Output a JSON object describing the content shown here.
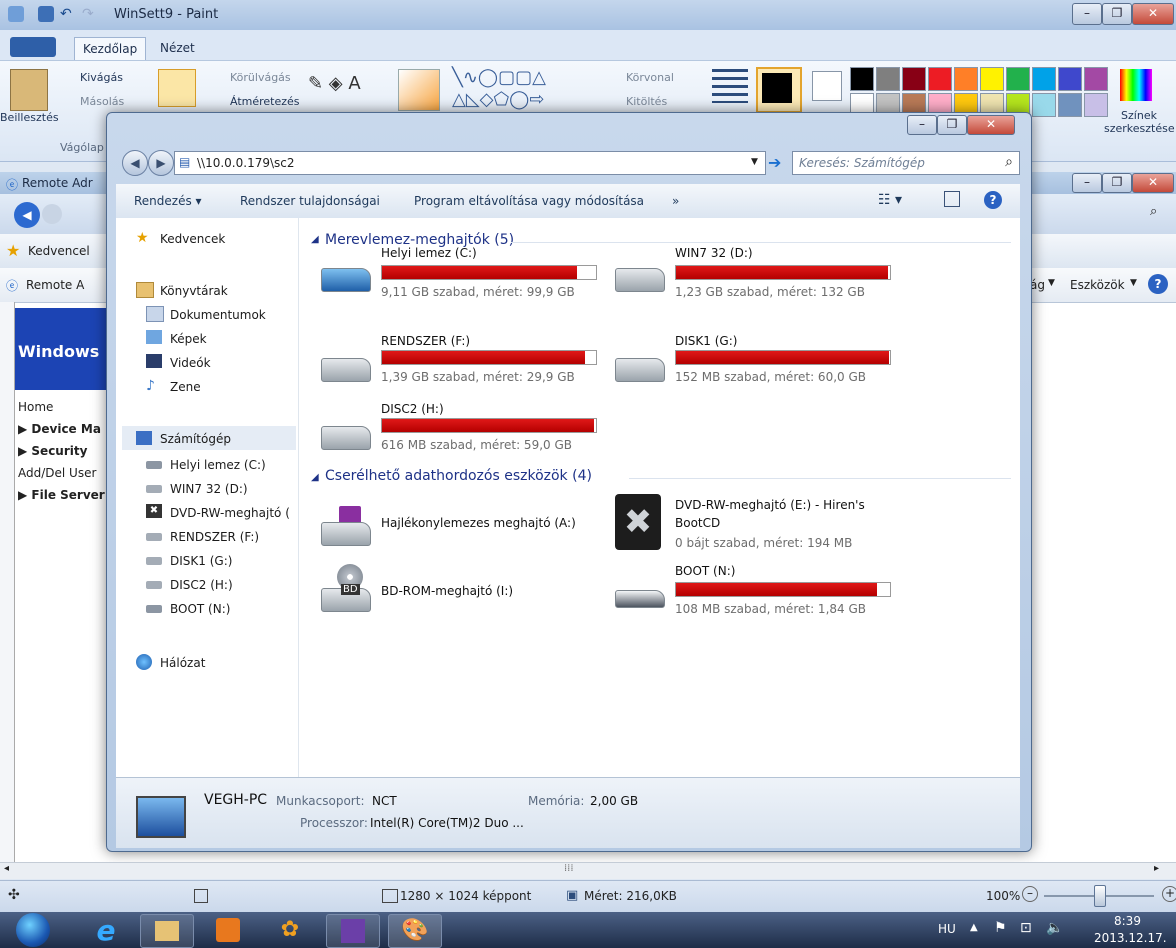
{
  "paint": {
    "title": "WinSett9 - Paint",
    "tabs": [
      "Kezdőlap",
      "Nézet"
    ],
    "clipboard": {
      "paste": "Beillesztés",
      "cut": "Kivágás",
      "copy": "Másolás",
      "group": "Vágólap"
    },
    "image": {
      "crop": "Körülvágás",
      "resize": "Átméretezés"
    },
    "shapes": {
      "outline": "Körvonal",
      "fill": "Kitöltés"
    },
    "colors_edit": "Színek szerkesztése",
    "palette_row1": [
      "#000000",
      "#7f7f7f",
      "#880015",
      "#ed1c24",
      "#ff7f27",
      "#fff200",
      "#22b14c",
      "#00a2e8",
      "#3f48cc",
      "#a349a4"
    ],
    "palette_row2": [
      "#ffffff",
      "#c3c3c3",
      "#b97a57",
      "#ffaec9",
      "#ffc90e",
      "#efe4b0",
      "#b5e61d",
      "#99d9ea",
      "#7092be",
      "#c8bfe7"
    ],
    "status": {
      "dimensions": "1280 × 1024 képpont",
      "size": "Méret: 216,0KB",
      "zoom": "100%"
    }
  },
  "ie": {
    "title": "Remote Adr",
    "favorites": "Kedvencel",
    "tab": "Remote A",
    "tools": "Eszközök",
    "page_menu": "ág",
    "banner": "Windows",
    "nav": [
      "Home",
      "Device Ma",
      "Security",
      "Add/Del User",
      "File Server"
    ]
  },
  "explorer": {
    "address": "\\\\10.0.0.179\\sc2",
    "search_placeholder": "Keresés: Számítógép",
    "commands": [
      "Rendezés",
      "Rendszer tulajdonságai",
      "Program eltávolítása vagy módosítása",
      "»"
    ],
    "nav": {
      "favorites": "Kedvencek",
      "libraries": "Könyvtárak",
      "libs": [
        "Dokumentumok",
        "Képek",
        "Videók",
        "Zene"
      ],
      "computer": "Számítógép",
      "drives": [
        "Helyi lemez (C:)",
        "WIN7 32 (D:)",
        "DVD-RW-meghajtó (",
        "RENDSZER (F:)",
        "DISK1 (G:)",
        "DISC2 (H:)",
        "BOOT (N:)"
      ],
      "network": "Hálózat"
    },
    "hdd_group": "Merevlemez-meghajtók (5)",
    "removable_group": "Cserélhető adathordozós eszközök (4)",
    "hdds": [
      {
        "name": "Helyi lemez (C:)",
        "info": "9,11 GB szabad, méret: 99,9 GB",
        "used": 0.91
      },
      {
        "name": "WIN7 32 (D:)",
        "info": "1,23 GB szabad, méret: 132 GB",
        "used": 0.99
      },
      {
        "name": "RENDSZER (F:)",
        "info": "1,39 GB szabad, méret: 29,9 GB",
        "used": 0.95
      },
      {
        "name": "DISK1 (G:)",
        "info": "152 MB szabad, méret: 60,0 GB",
        "used": 0.997
      },
      {
        "name": "DISC2 (H:)",
        "info": "616 MB szabad, méret: 59,0 GB",
        "used": 0.99
      }
    ],
    "removables": [
      {
        "name": "Hajlékonylemezes meghajtó (A:)"
      },
      {
        "name": "DVD-RW-meghajtó (E:) - Hiren's",
        "name2": "BootCD",
        "info": "0 bájt szabad, méret: 194 MB"
      },
      {
        "name": "BD-ROM-meghajtó (I:)"
      },
      {
        "name": "BOOT (N:)",
        "info": "108 MB szabad, méret: 1,84 GB",
        "used": 0.94
      }
    ],
    "status": {
      "pc": "VEGH-PC",
      "workgroup_label": "Munkacsoport:",
      "workgroup": "NCT",
      "memory_label": "Memória:",
      "memory": "2,00 GB",
      "cpu_label": "Processzor:",
      "cpu": "Intel(R) Core(TM)2 Duo ..."
    }
  },
  "taskbar": {
    "lang": "HU",
    "time": "8:39",
    "date": "2013.12.17."
  }
}
